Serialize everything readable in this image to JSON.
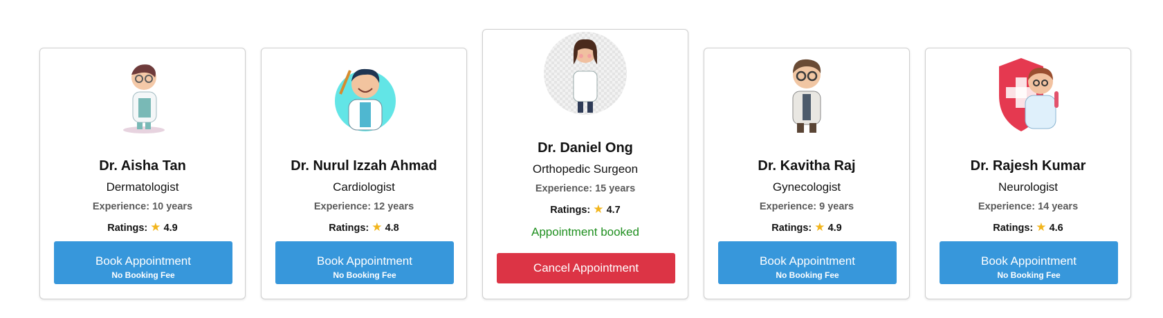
{
  "doctors": [
    {
      "name": "Dr. Aisha Tan",
      "specialty": "Dermatologist",
      "experience": "Experience: 10 years",
      "ratings_label": "Ratings:",
      "rating": "4.9",
      "button_label": "Book Appointment",
      "button_sub": "No Booking Fee",
      "avatar_icon": "doctor-avatar-icon"
    },
    {
      "name": "Dr. Nurul Izzah Ahmad",
      "specialty": "Cardiologist",
      "experience": "Experience: 12 years",
      "ratings_label": "Ratings:",
      "rating": "4.8",
      "button_label": "Book Appointment",
      "button_sub": "No Booking Fee",
      "avatar_icon": "doctor-avatar-icon"
    },
    {
      "name": "Dr. Daniel Ong",
      "specialty": "Orthopedic Surgeon",
      "experience": "Experience: 15 years",
      "ratings_label": "Ratings:",
      "rating": "4.7",
      "status": "Appointment booked",
      "button_label": "Cancel Appointment",
      "avatar_icon": "doctor-avatar-icon"
    },
    {
      "name": "Dr. Kavitha Raj",
      "specialty": "Gynecologist",
      "experience": "Experience: 9 years",
      "ratings_label": "Ratings:",
      "rating": "4.9",
      "button_label": "Book Appointment",
      "button_sub": "No Booking Fee",
      "avatar_icon": "doctor-avatar-icon"
    },
    {
      "name": "Dr. Rajesh Kumar",
      "specialty": "Neurologist",
      "experience": "Experience: 14 years",
      "ratings_label": "Ratings:",
      "rating": "4.6",
      "button_label": "Book Appointment",
      "button_sub": "No Booking Fee",
      "avatar_icon": "doctor-avatar-icon"
    }
  ],
  "star_icon": "star-icon",
  "colors": {
    "book": "#3797db",
    "cancel": "#dc3445",
    "booked": "#1f8f1f"
  }
}
